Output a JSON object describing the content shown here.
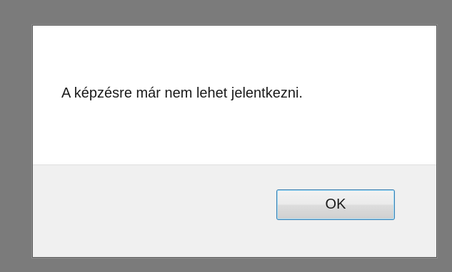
{
  "dialog": {
    "message": "A képzésre már nem lehet jelentkezni.",
    "ok_label": "OK"
  }
}
